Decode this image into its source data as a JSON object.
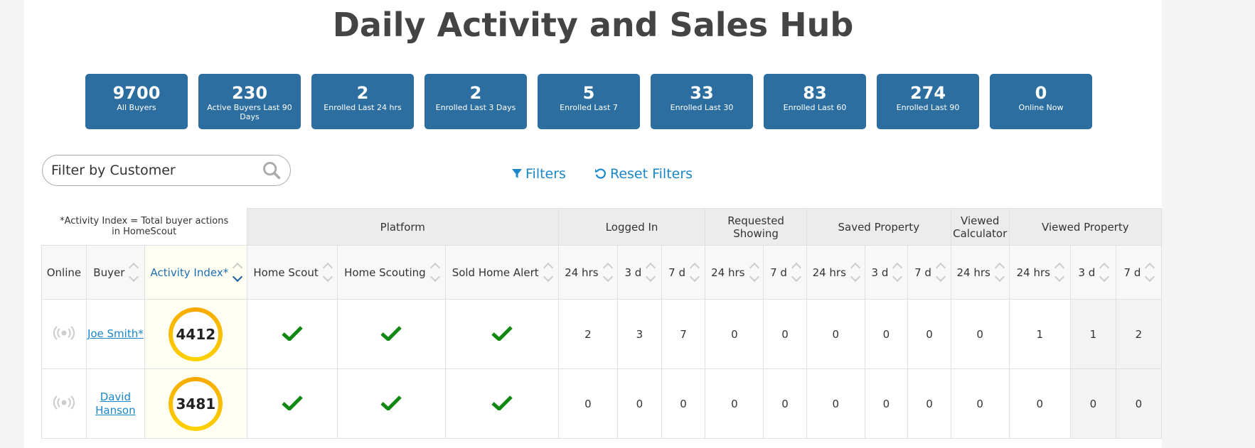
{
  "title": "Daily Activity and Sales Hub",
  "stats": [
    {
      "num": "9700",
      "label": "All Buyers"
    },
    {
      "num": "230",
      "label": "Active Buyers Last 90 Days"
    },
    {
      "num": "2",
      "label": "Enrolled Last 24 hrs"
    },
    {
      "num": "2",
      "label": "Enrolled Last 3 Days"
    },
    {
      "num": "5",
      "label": "Enrolled Last 7"
    },
    {
      "num": "33",
      "label": "Enrolled Last 30"
    },
    {
      "num": "83",
      "label": "Enrolled Last 60"
    },
    {
      "num": "274",
      "label": "Enrolled Last 90"
    },
    {
      "num": "0",
      "label": "Online Now"
    }
  ],
  "search": {
    "placeholder": "Filter by Customer"
  },
  "filters": {
    "filters_label": "Filters",
    "reset_label": "Reset Filters"
  },
  "table": {
    "note": "*Activity Index = Total buyer actions in HomeScout",
    "groups": {
      "platform": "Platform",
      "logged_in": "Logged In",
      "requested_showing": "Requested Showing",
      "saved_property": "Saved Property",
      "viewed_calculator": "Viewed Calculator",
      "viewed_property": "Viewed Property"
    },
    "columns": {
      "online": "Online",
      "buyer": "Buyer",
      "activity_index": "Activity Index*",
      "home_scout": "Home Scout",
      "home_scouting": "Home Scouting",
      "sold_home_alert": "Sold Home Alert",
      "h24": "24 hrs",
      "d3": "3 d",
      "d7": "7 d"
    },
    "rows": [
      {
        "buyer": "Joe Smith*",
        "activity": "4412",
        "logged": [
          "2",
          "3",
          "7"
        ],
        "requested": [
          "0",
          "0"
        ],
        "saved": [
          "0",
          "0",
          "0"
        ],
        "calc": [
          "0"
        ],
        "viewed": [
          "1",
          "1",
          "2"
        ]
      },
      {
        "buyer": "David Hanson",
        "activity": "3481",
        "logged": [
          "0",
          "0",
          "0"
        ],
        "requested": [
          "0",
          "0"
        ],
        "saved": [
          "0",
          "0",
          "0"
        ],
        "calc": [
          "0"
        ],
        "viewed": [
          "0",
          "0",
          "0"
        ]
      }
    ]
  },
  "colors": {
    "stat_bg": "#2c6ea0",
    "accent": "#1a87c9",
    "check": "#118811"
  }
}
